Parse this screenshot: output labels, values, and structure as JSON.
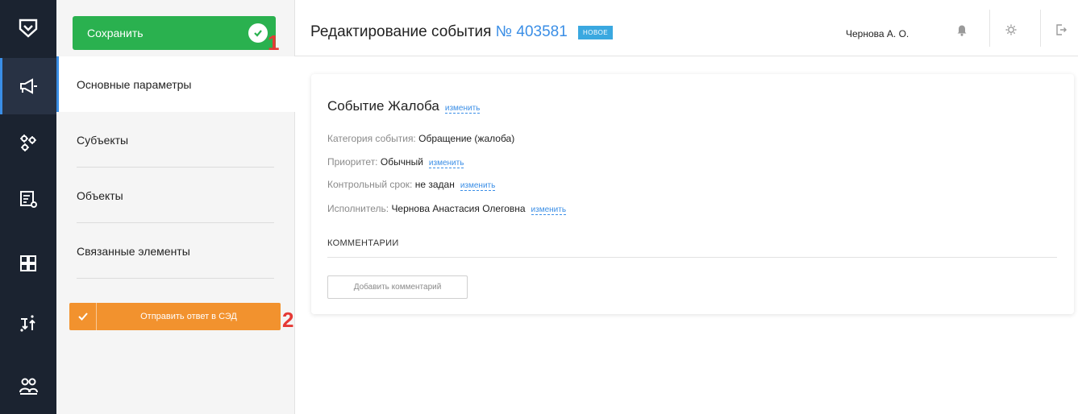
{
  "toolbar": {
    "save_label": "Сохранить",
    "send_label": "Отправить ответ в СЭД"
  },
  "callouts": [
    "1",
    "2"
  ],
  "rail": {
    "icons": [
      "logo-shield-icon",
      "megaphone-icon",
      "gears-icon",
      "report-icon",
      "grid-icon",
      "sort-icon",
      "users-icon"
    ]
  },
  "nav": {
    "items": [
      {
        "label": "Основные параметры",
        "active": true
      },
      {
        "label": "Субъекты"
      },
      {
        "label": "Объекты"
      },
      {
        "label": "Связанные элементы"
      }
    ]
  },
  "header": {
    "title": "Редактирование события",
    "number": "№ 403581",
    "badge": "НОВОЕ",
    "user": "Чернова А. О."
  },
  "event": {
    "title": "Событие Жалоба",
    "edit_link": "изменить",
    "category_label": "Категория события:",
    "category_value": "Обращение (жалоба)",
    "priority_label": "Приоритет:",
    "priority_value": "Обычный",
    "deadline_label": "Контрольный срок:",
    "deadline_value": "не задан",
    "executor_label": "Исполнитель:",
    "executor_value": "Чернова Анастасия Олеговна",
    "comments_title": "КОММЕНТАРИИ",
    "add_comment": "Добавить комментарий"
  },
  "colors": {
    "rail_bg": "#1b2330",
    "save_green": "#2ab14f",
    "send_orange": "#f2922e",
    "link_blue": "#3a8ee6",
    "badge_blue": "#3aa8e0",
    "callout_red": "#e53935"
  }
}
